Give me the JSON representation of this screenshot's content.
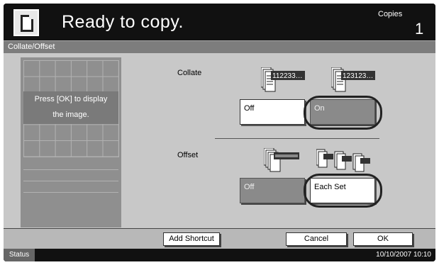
{
  "header": {
    "title": "Ready to copy.",
    "copies_label": "Copies",
    "copies_value": "1"
  },
  "tab": {
    "label": "Collate/Offset"
  },
  "preview": {
    "message_line1": "Press [OK] to display",
    "message_line2": "the image."
  },
  "collate": {
    "label": "Collate",
    "icon_uncollated_text": "112233…",
    "icon_collated_text": "123123…",
    "off_label": "Off",
    "on_label": "On",
    "selected": "On"
  },
  "offset": {
    "label": "Offset",
    "off_label": "Off",
    "each_set_label": "Each Set",
    "selected": "Each Set"
  },
  "bottom": {
    "add_shortcut": "Add Shortcut",
    "cancel": "Cancel",
    "ok": "OK"
  },
  "status": {
    "label": "Status",
    "datetime": "10/10/2007   10:10"
  },
  "colors": {
    "header_bg": "#111111",
    "panel_bg": "#c8c8c8",
    "selected_btn": "#8a8a8a"
  }
}
